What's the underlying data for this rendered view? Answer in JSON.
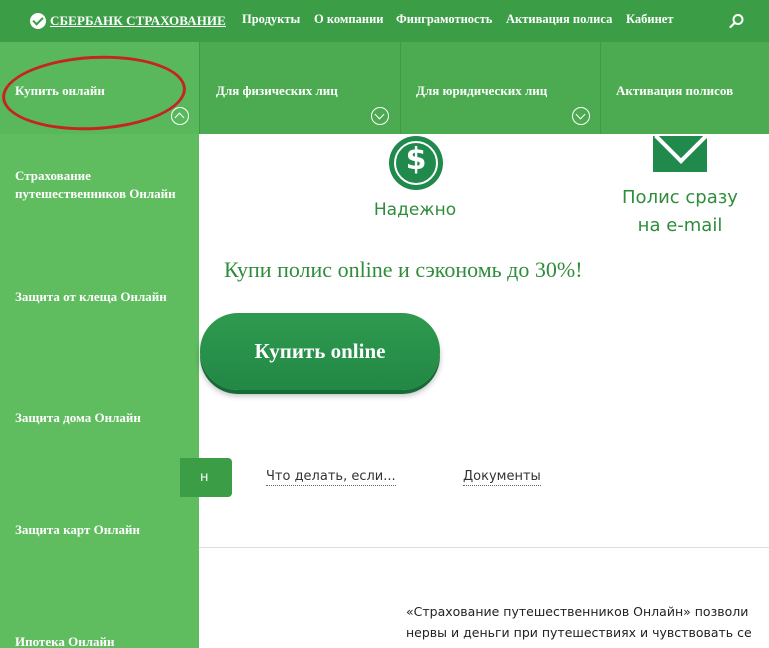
{
  "header": {
    "logo_text": "СБЕРБАНК СТРАХОВАНИЕ",
    "nav": [
      "Продукты",
      "О компании",
      "Финграмотность",
      "Активация полиса",
      "Кабинет"
    ]
  },
  "subnav": {
    "items": [
      "Купить онлайн",
      "Для физических лиц",
      "Для юридических лиц",
      "Активация полисов"
    ]
  },
  "sidebar": {
    "items": [
      "Страхование путешественников Онлайн",
      "Защита от клеща Онлайн",
      "Защита дома Онлайн",
      "Защита карт Онлайн",
      "Ипотека Онлайн"
    ]
  },
  "features": {
    "reliable": "Надежно",
    "email_line1": "Полис сразу",
    "email_line2": "на e-mail",
    "dollar_glyph": "$"
  },
  "promo": {
    "text": "Купи полис online и сэкономь до 30%!",
    "button": "Купить online"
  },
  "tabs": {
    "active_fragment": "н",
    "links": [
      "Что делать, если...",
      "Документы"
    ]
  },
  "description": {
    "line1": "«Страхование путешественников Онлайн» позволи",
    "line2": "нервы и деньги при путешествиях и чувствовать се"
  },
  "colors": {
    "brand_green": "#3b9d46",
    "accent_dark_green": "#1f8a4c",
    "sidebar_green": "#5fbc5f",
    "annotation_red": "#c4261f"
  }
}
